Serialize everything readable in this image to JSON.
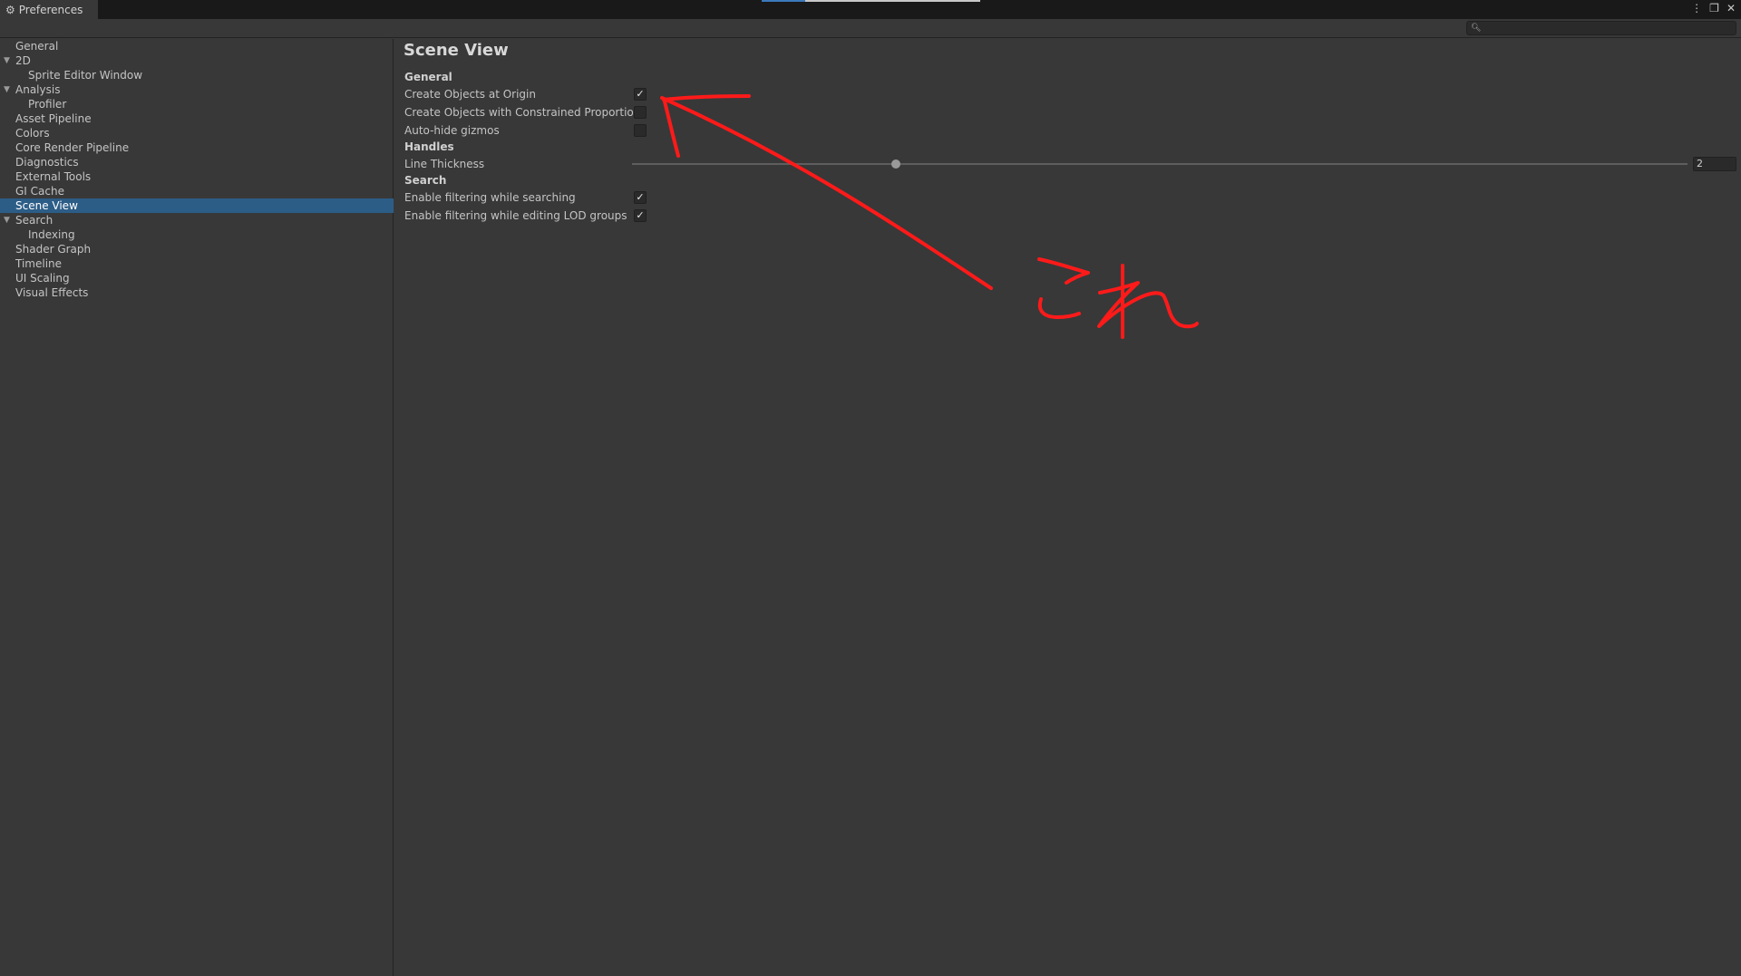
{
  "window": {
    "tab_title": "Preferences",
    "tab_icon": "gear-icon"
  },
  "search": {
    "placeholder": "",
    "value": ""
  },
  "sidebar": {
    "selected": "Scene View",
    "items": [
      {
        "label": "General",
        "level": 0,
        "expandable": false
      },
      {
        "label": "2D",
        "level": 0,
        "expandable": true
      },
      {
        "label": "Sprite Editor Window",
        "level": 1,
        "expandable": false
      },
      {
        "label": "Analysis",
        "level": 0,
        "expandable": true
      },
      {
        "label": "Profiler",
        "level": 1,
        "expandable": false
      },
      {
        "label": "Asset Pipeline",
        "level": 0,
        "expandable": false
      },
      {
        "label": "Colors",
        "level": 0,
        "expandable": false
      },
      {
        "label": "Core Render Pipeline",
        "level": 0,
        "expandable": false
      },
      {
        "label": "Diagnostics",
        "level": 0,
        "expandable": false
      },
      {
        "label": "External Tools",
        "level": 0,
        "expandable": false
      },
      {
        "label": "GI Cache",
        "level": 0,
        "expandable": false
      },
      {
        "label": "Scene View",
        "level": 0,
        "expandable": false
      },
      {
        "label": "Search",
        "level": 0,
        "expandable": true
      },
      {
        "label": "Indexing",
        "level": 1,
        "expandable": false
      },
      {
        "label": "Shader Graph",
        "level": 0,
        "expandable": false
      },
      {
        "label": "Timeline",
        "level": 0,
        "expandable": false
      },
      {
        "label": "UI Scaling",
        "level": 0,
        "expandable": false
      },
      {
        "label": "Visual Effects",
        "level": 0,
        "expandable": false
      }
    ]
  },
  "main": {
    "title": "Scene View",
    "general": {
      "heading": "General",
      "create_objects_at_origin": {
        "label": "Create Objects at Origin",
        "checked": true
      },
      "constrained_proportions": {
        "label": "Create Objects with Constrained Proportions",
        "checked": false
      },
      "auto_hide_gizmos": {
        "label": "Auto-hide gizmos",
        "checked": false
      }
    },
    "handles": {
      "heading": "Handles",
      "line_thickness": {
        "label": "Line Thickness",
        "value": "2",
        "min": 1,
        "max": 5
      }
    },
    "search": {
      "heading": "Search",
      "filter_searching": {
        "label": "Enable filtering while searching",
        "checked": true
      },
      "filter_lod": {
        "label": "Enable filtering while editing LOD groups",
        "checked": true
      }
    }
  },
  "annotation": {
    "handwritten_text": "これ",
    "color": "#ff1a1a"
  },
  "colors": {
    "selection": "#2c5d87",
    "background": "#383838",
    "titlebar": "#191919"
  }
}
